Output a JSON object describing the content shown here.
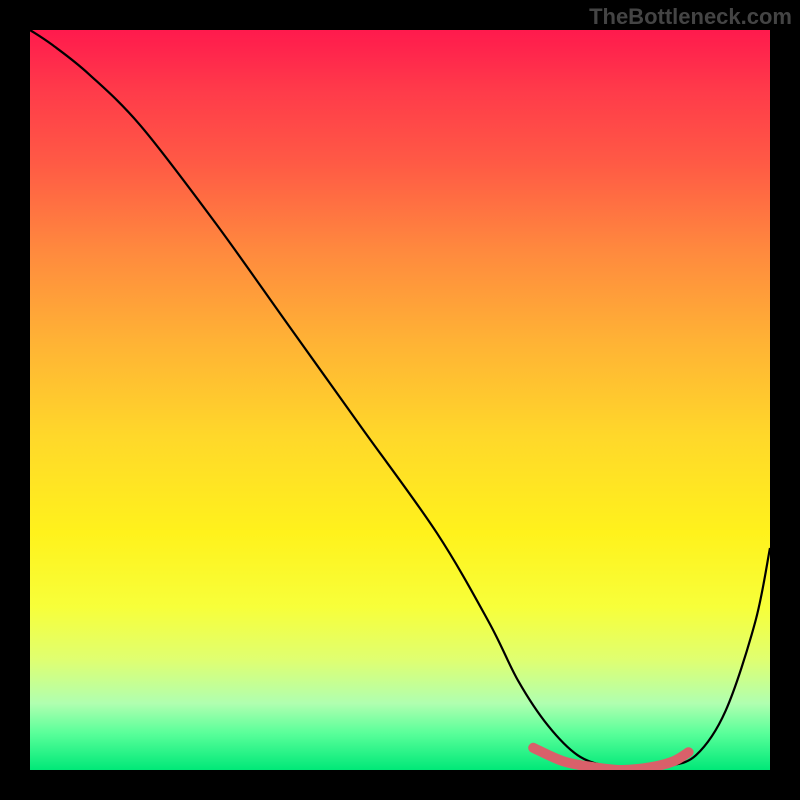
{
  "watermark": "TheBottleneck.com",
  "chart_data": {
    "type": "line",
    "title": "",
    "xlabel": "",
    "ylabel": "",
    "xlim": [
      0,
      100
    ],
    "ylim": [
      0,
      100
    ],
    "series": [
      {
        "name": "bottleneck-curve",
        "x": [
          0,
          3,
          8,
          15,
          25,
          35,
          45,
          55,
          62,
          66,
          70,
          74,
          78,
          82,
          86,
          90,
          94,
          98,
          100
        ],
        "y": [
          100,
          98,
          94,
          87,
          74,
          60,
          46,
          32,
          20,
          12,
          6,
          2,
          0.5,
          0,
          0.5,
          2,
          8,
          20,
          30
        ]
      },
      {
        "name": "highlight-segment",
        "x": [
          68,
          72,
          76,
          80,
          84,
          87,
          89
        ],
        "y": [
          3,
          1.2,
          0.4,
          0,
          0.4,
          1.2,
          2.4
        ]
      }
    ],
    "gradient_stops": [
      {
        "pos": 0,
        "color": "#ff1a4d"
      },
      {
        "pos": 50,
        "color": "#ffd82a"
      },
      {
        "pos": 78,
        "color": "#f7ff3a"
      },
      {
        "pos": 100,
        "color": "#00e878"
      }
    ]
  }
}
